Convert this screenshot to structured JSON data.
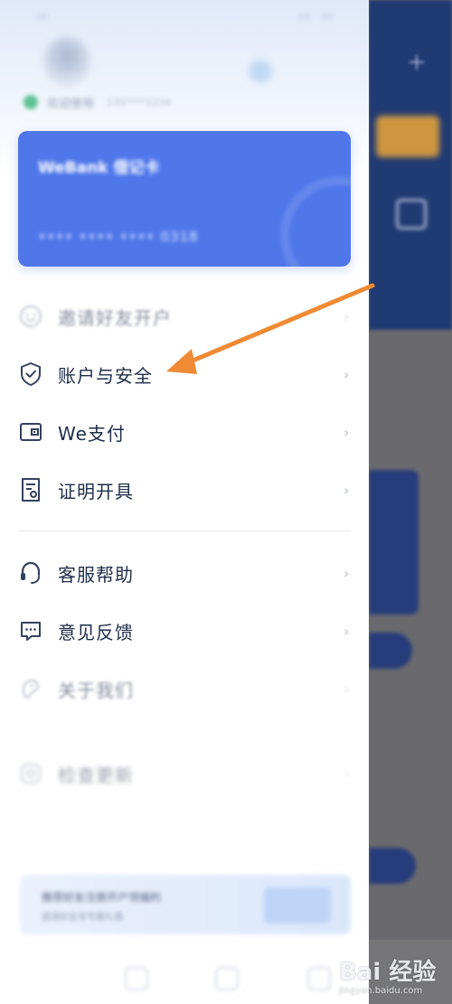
{
  "drawer": {
    "user_name": "欢迎使用",
    "user_account": "135****1234",
    "card": {
      "title": "WeBank 借记卡",
      "number": "•••• •••• •••• 0318"
    }
  },
  "menu": {
    "items": [
      {
        "label": "邀请好友开户",
        "icon": "smile-icon",
        "state": "faded"
      },
      {
        "label": "账户与安全",
        "icon": "shield-check-icon",
        "state": "normal"
      },
      {
        "label": "We支付",
        "icon": "wallet-icon",
        "state": "normal"
      },
      {
        "label": "证明开具",
        "icon": "certificate-icon",
        "state": "normal"
      },
      {
        "label": "客服帮助",
        "icon": "headset-icon",
        "state": "normal"
      },
      {
        "label": "意见反馈",
        "icon": "chat-bubble-icon",
        "state": "normal"
      },
      {
        "label": "关于我们",
        "icon": "about-icon",
        "state": "faded"
      },
      {
        "label": "检查更新",
        "icon": "settings-icon",
        "state": "very-faded"
      }
    ]
  },
  "banner": {
    "title": "推荐好友注册开户领福利",
    "subtitle": "邀请好友享专属礼遇"
  },
  "watermark": {
    "brand": "Bai 经验",
    "url": "jingyan.baidu.com"
  },
  "colors": {
    "accent": "#4f77ea",
    "arrow": "#f08a34",
    "text": "#1f2d4a"
  }
}
